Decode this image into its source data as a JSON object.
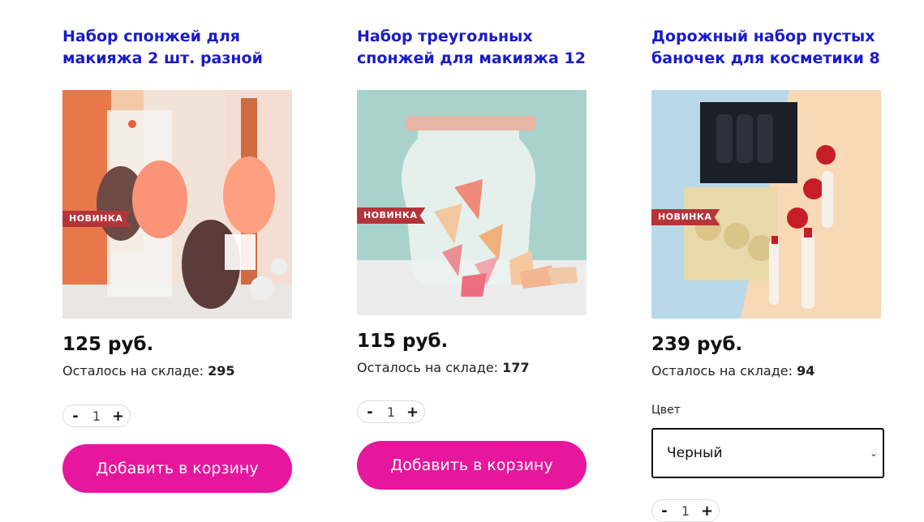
{
  "products": [
    {
      "title_line1": "Набор спонжей для",
      "title_line2": "макияжа 2 шт. разной",
      "badge": "НОВИНКА",
      "price": "125 руб.",
      "stock_label": "Осталось на складе:",
      "stock_value": "295",
      "qty": "1",
      "qty_minus": "-",
      "qty_plus": "+",
      "add_label": "Добавить в корзину"
    },
    {
      "title_line1": "Набор треугольных",
      "title_line2": "спонжей для макияжа 12",
      "badge": "НОВИНКА",
      "price": "115 руб.",
      "stock_label": "Осталось на складе:",
      "stock_value": "177",
      "qty": "1",
      "qty_minus": "-",
      "qty_plus": "+",
      "add_label": "Добавить в корзину"
    },
    {
      "title_line1": "Дорожный набор пустых",
      "title_line2": "баночек для косметики 8",
      "badge": "НОВИНКА",
      "price": "239 руб.",
      "stock_label": "Осталось на складе:",
      "stock_value": "94",
      "color_label": "Цвет",
      "color_selected": "Черный",
      "qty": "1",
      "qty_minus": "-",
      "qty_plus": "+"
    }
  ],
  "colors": {
    "title": "#1a1acc",
    "button": "#e6179c",
    "badge": "#b5343a"
  }
}
